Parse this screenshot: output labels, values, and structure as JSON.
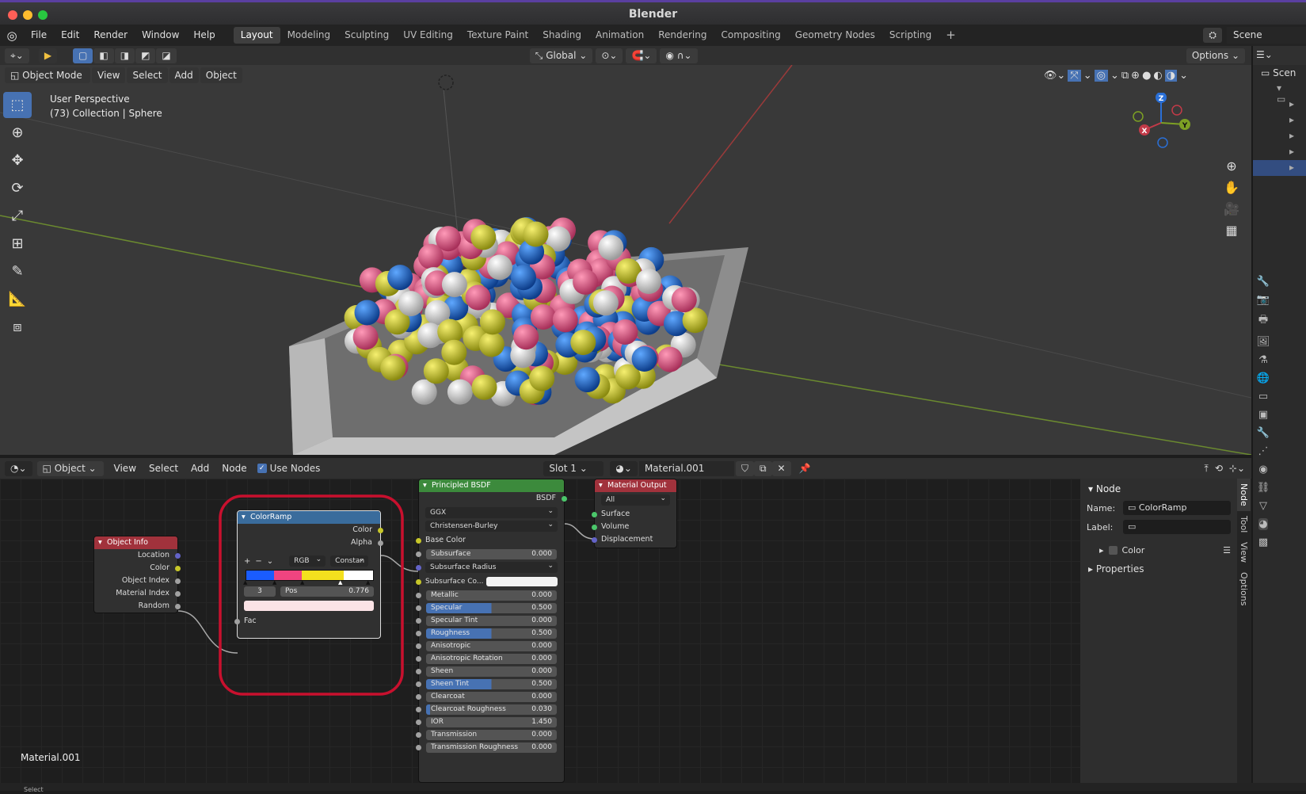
{
  "window": {
    "title": "Blender"
  },
  "menu": [
    "File",
    "Edit",
    "Render",
    "Window",
    "Help"
  ],
  "workspaces": [
    {
      "label": "Layout",
      "active": true
    },
    {
      "label": "Modeling"
    },
    {
      "label": "Sculpting"
    },
    {
      "label": "UV Editing"
    },
    {
      "label": "Texture Paint"
    },
    {
      "label": "Shading"
    },
    {
      "label": "Animation"
    },
    {
      "label": "Rendering"
    },
    {
      "label": "Compositing"
    },
    {
      "label": "Geometry Nodes"
    },
    {
      "label": "Scripting"
    }
  ],
  "scene": {
    "label": "Scene"
  },
  "tool_header": {
    "orientation": "Global",
    "options": "Options"
  },
  "viewport": {
    "mode": "Object Mode",
    "menus": [
      "View",
      "Select",
      "Add",
      "Object"
    ],
    "info_line1": "User Perspective",
    "info_line2": "(73) Collection | Sphere",
    "axes": {
      "x": "X",
      "y": "Y",
      "z": "Z"
    }
  },
  "outliner": {
    "label": "Scen"
  },
  "node_header": {
    "object": "Object",
    "menus": [
      "View",
      "Select",
      "Add",
      "Node"
    ],
    "use_nodes": "Use Nodes",
    "slot": "Slot 1",
    "material": "Material.001"
  },
  "nodes": {
    "object_info": {
      "title": "Object Info",
      "outputs": [
        "Location",
        "Color",
        "Object Index",
        "Material Index",
        "Random"
      ]
    },
    "color_ramp": {
      "title": "ColorRamp",
      "outputs": [
        "Color",
        "Alpha"
      ],
      "color_mode": "RGB",
      "interpolation": "Constan",
      "stop_index": "3",
      "pos_label": "Pos",
      "pos_value": "0.776",
      "input": "Fac"
    },
    "principled": {
      "title": "Principled BSDF",
      "output": "BSDF",
      "distribution": "GGX",
      "subsurface_method": "Christensen-Burley",
      "base_color": "Base Color",
      "subsurface_radius": "Subsurface Radius",
      "subsurface_color": "Subsurface Co...",
      "fields": [
        {
          "label": "Subsurface",
          "value": "0.000",
          "fill": 0
        },
        {
          "label": "Metallic",
          "value": "0.000",
          "fill": 0
        },
        {
          "label": "Specular",
          "value": "0.500",
          "fill": 0.5
        },
        {
          "label": "Specular Tint",
          "value": "0.000",
          "fill": 0
        },
        {
          "label": "Roughness",
          "value": "0.500",
          "fill": 0.5
        },
        {
          "label": "Anisotropic",
          "value": "0.000",
          "fill": 0
        },
        {
          "label": "Anisotropic Rotation",
          "value": "0.000",
          "fill": 0
        },
        {
          "label": "Sheen",
          "value": "0.000",
          "fill": 0
        },
        {
          "label": "Sheen Tint",
          "value": "0.500",
          "fill": 0.5
        },
        {
          "label": "Clearcoat",
          "value": "0.000",
          "fill": 0
        },
        {
          "label": "Clearcoat Roughness",
          "value": "0.030",
          "fill": 0.03
        },
        {
          "label": "IOR",
          "value": "1.450",
          "fill": 0
        },
        {
          "label": "Transmission",
          "value": "0.000",
          "fill": 0
        },
        {
          "label": "Transmission Roughness",
          "value": "0.000",
          "fill": 0
        }
      ]
    },
    "material_output": {
      "title": "Material Output",
      "target": "All",
      "inputs": [
        "Surface",
        "Volume",
        "Displacement"
      ]
    }
  },
  "node_footer": {
    "material": "Material.001"
  },
  "npanel": {
    "section": "Node",
    "name_label": "Name:",
    "name_value": "ColorRamp",
    "label_label": "Label:",
    "color_label": "Color",
    "properties_label": "Properties",
    "tabs": [
      "Node",
      "Tool",
      "View",
      "Options"
    ]
  },
  "status": {
    "select": "Select"
  }
}
